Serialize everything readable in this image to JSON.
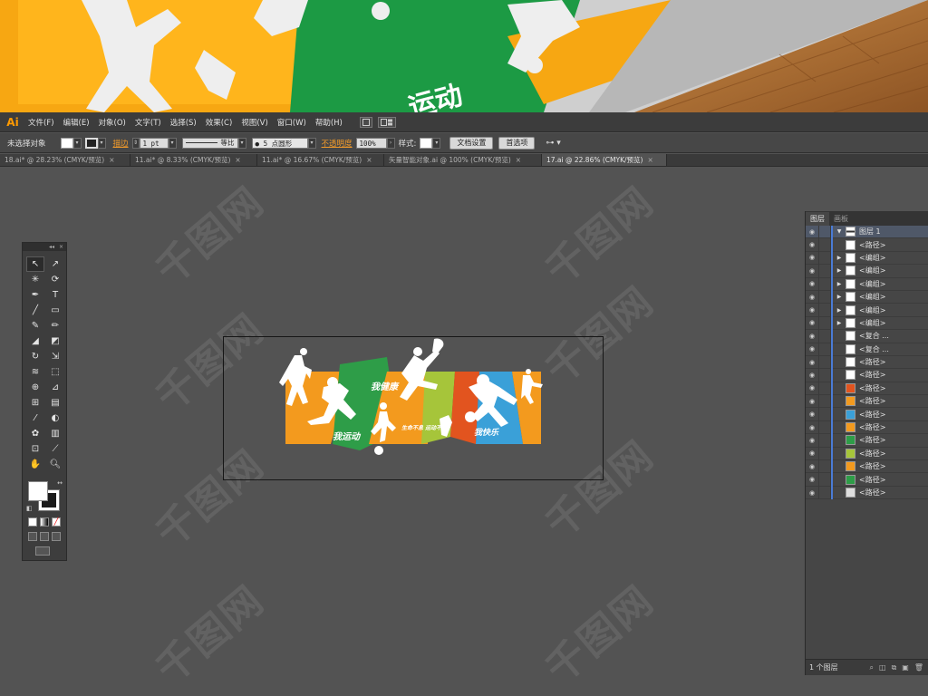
{
  "app": {
    "logo": "Ai",
    "menu": [
      "文件(F)",
      "编辑(E)",
      "对象(O)",
      "文字(T)",
      "选择(S)",
      "效果(C)",
      "视图(V)",
      "窗口(W)",
      "帮助(H)"
    ]
  },
  "control_bar": {
    "selection_status": "未选择对象",
    "stroke_label": "描边",
    "stroke_weight": "1 pt",
    "stroke_profile": "等比",
    "brush": "5 点圆形",
    "opacity_label": "不透明度",
    "opacity_value": "100%",
    "style_label": "样式:",
    "doc_setup_button": "文档设置",
    "preferences_button": "首选项"
  },
  "doc_tabs": [
    {
      "label": "18.ai* @ 28.23% (CMYK/预览)",
      "active": false
    },
    {
      "label": "11.ai* @ 8.33% (CMYK/预览)",
      "active": false
    },
    {
      "label": "11.ai* @ 16.67% (CMYK/预览)",
      "active": false
    },
    {
      "label": "矢量智能对象.ai @ 100% (CMYK/预览)",
      "active": false
    },
    {
      "label": "17.ai @ 22.86% (CMYK/预览)",
      "active": true
    }
  ],
  "artwork": {
    "slogan_1": "我运动",
    "slogan_2": "我健康",
    "slogan_3": "生命不息 运动不止",
    "slogan_4": "我快乐",
    "colors": {
      "orange": "#f39a1e",
      "green": "#2e9d48",
      "lime": "#a6c53a",
      "red": "#e2541f",
      "blue": "#3aa0d8"
    }
  },
  "layers_panel": {
    "tabs": [
      "图层",
      "画板"
    ],
    "top_layer": "图层 1",
    "rows": [
      {
        "name": "<路径>",
        "twirl": false,
        "thumb": "#ffffff"
      },
      {
        "name": "<编组>",
        "twirl": true,
        "thumb": "#ffffff"
      },
      {
        "name": "<编组>",
        "twirl": true,
        "thumb": "#ffffff"
      },
      {
        "name": "<编组>",
        "twirl": true,
        "thumb": "#ffffff"
      },
      {
        "name": "<编组>",
        "twirl": true,
        "thumb": "#ffffff"
      },
      {
        "name": "<编组>",
        "twirl": true,
        "thumb": "#ffffff"
      },
      {
        "name": "<编组>",
        "twirl": true,
        "thumb": "#ffffff"
      },
      {
        "name": "<复合 ...",
        "twirl": false,
        "thumb": "#ffffff"
      },
      {
        "name": "<复合 ...",
        "twirl": false,
        "thumb": "#ffffff"
      },
      {
        "name": "<路径>",
        "twirl": false,
        "thumb": "#ffffff"
      },
      {
        "name": "<路径>",
        "twirl": false,
        "thumb": "#ffffff"
      },
      {
        "name": "<路径>",
        "twirl": false,
        "thumb": "#e2541f"
      },
      {
        "name": "<路径>",
        "twirl": false,
        "thumb": "#f39a1e"
      },
      {
        "name": "<路径>",
        "twirl": false,
        "thumb": "#3aa0d8"
      },
      {
        "name": "<路径>",
        "twirl": false,
        "thumb": "#f39a1e"
      },
      {
        "name": "<路径>",
        "twirl": false,
        "thumb": "#2e9d48"
      },
      {
        "name": "<路径>",
        "twirl": false,
        "thumb": "#a6c53a"
      },
      {
        "name": "<路径>",
        "twirl": false,
        "thumb": "#f39a1e"
      },
      {
        "name": "<路径>",
        "twirl": false,
        "thumb": "#2e9d48"
      },
      {
        "name": "<路径>",
        "twirl": false,
        "thumb": "#dddddd"
      }
    ],
    "footer": "1 个图层"
  },
  "watermark": "千图网"
}
